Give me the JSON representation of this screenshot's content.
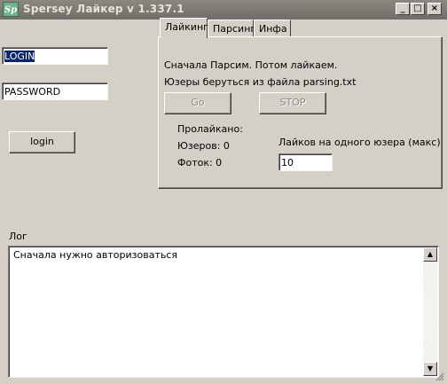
{
  "window": {
    "icon_text": "Sp",
    "title": "Spersey Лайкер v 1.337.1",
    "minimize_glyph": "_",
    "maximize_glyph": "□",
    "close_glyph": "×"
  },
  "login": {
    "login_value": "LOGIN",
    "password_value": "PASSWORD",
    "login_button": "login"
  },
  "tabs": [
    {
      "label": "Лайкинг",
      "active": true
    },
    {
      "label": "Парсинг",
      "active": false
    },
    {
      "label": "Инфа",
      "active": false
    }
  ],
  "liking": {
    "line1": "Сначала Парсим. Потом лайкаем.",
    "line2": "Юзеры беруться из файла parsing.txt",
    "go_button": "Go",
    "stop_button": "STOP",
    "liked_label": "Пролайкано:",
    "users_label": "Юзеров: 0",
    "photos_label": "Фоток: 0",
    "likes_per_user_label": "Лайков на одного юзера (макс)",
    "likes_per_user_value": "10"
  },
  "log": {
    "label": "Лог",
    "text": "Сначала нужно авторизоваться"
  },
  "icons": {
    "app": "app-icon",
    "scroll_up": "arrow-up-icon",
    "scroll_down": "arrow-down-icon",
    "resize": "size-grip-icon"
  },
  "colors": {
    "face": "#d4d0c8",
    "selection": "#0a246a",
    "titlebar": "#7a7872"
  }
}
